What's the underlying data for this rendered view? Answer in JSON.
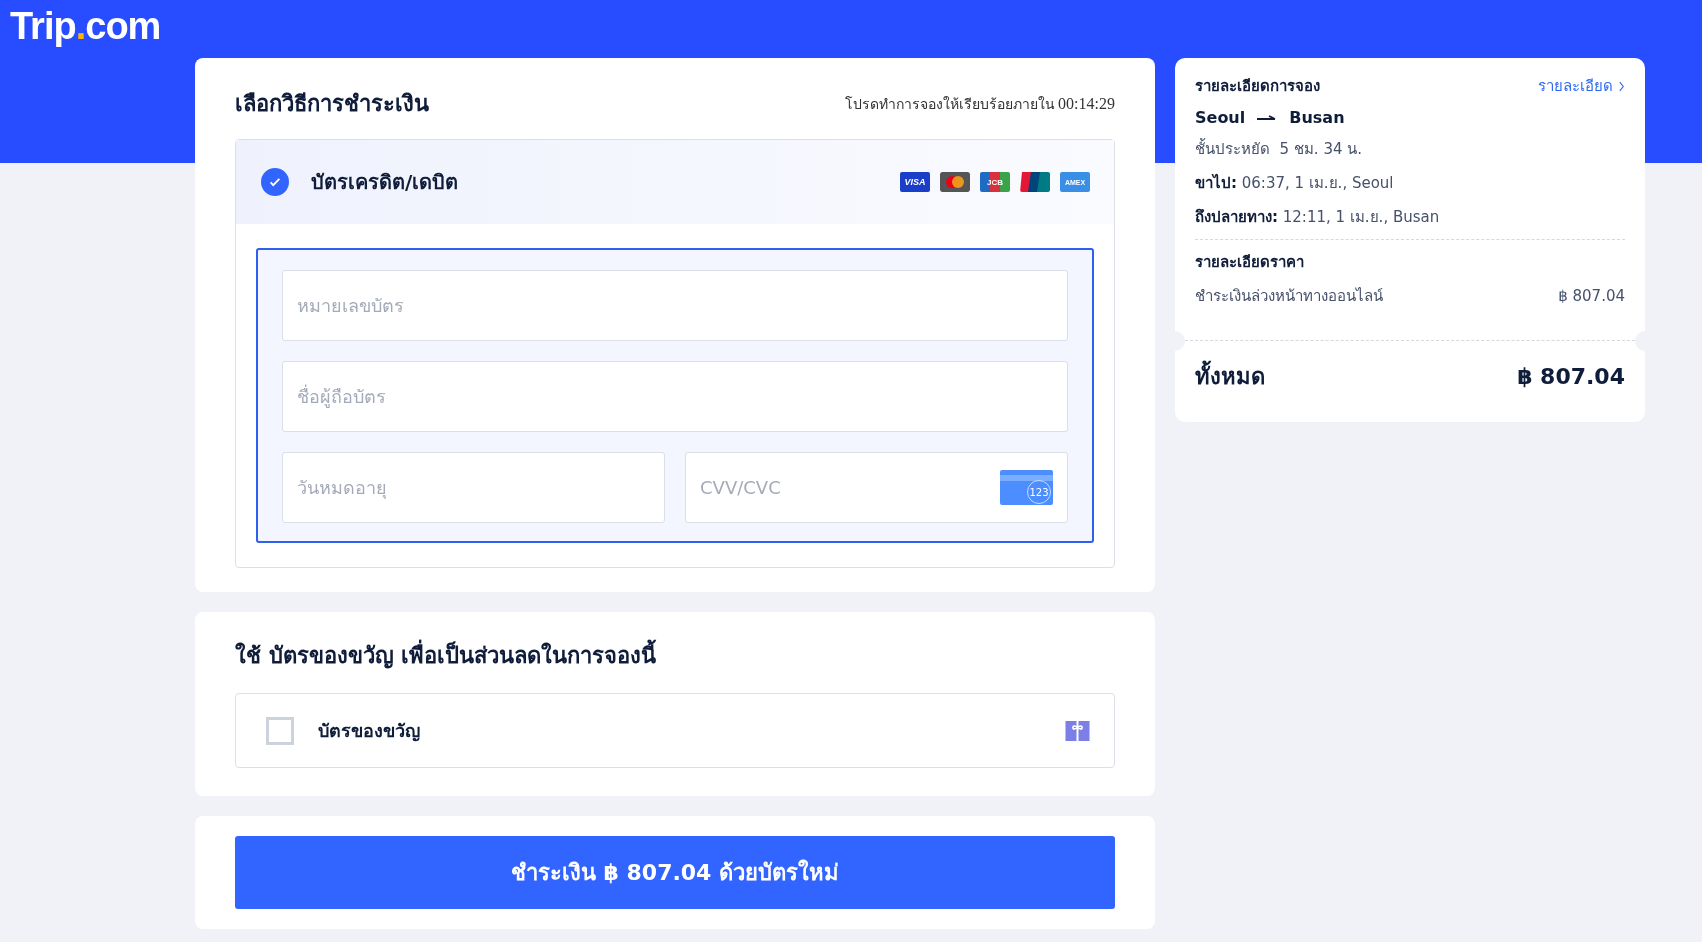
{
  "logo": {
    "parts": [
      "Trip",
      ".",
      "com"
    ]
  },
  "payment": {
    "title": "เลือกวิธีการชำระเงิน",
    "timer_label": "โปรดทำการจองให้เรียบร้อยภายใน",
    "timer": "00:14:29",
    "method": {
      "label": "บัตรเครดิต/เดบิต",
      "selected": true,
      "brands": [
        {
          "kind": "visa",
          "text": "VISA"
        },
        {
          "kind": "mastercard"
        },
        {
          "kind": "jcb",
          "text": "JCB"
        },
        {
          "kind": "unionpay"
        },
        {
          "kind": "amex",
          "text": "AMEX"
        }
      ]
    },
    "fields": [
      {
        "kind": "full",
        "placeholder": "หมายเลขบัตร"
      },
      {
        "kind": "full",
        "placeholder": "ชื่อผู้ถือบัตร"
      },
      {
        "kind": "half",
        "placeholder": "วันหมดอายุ"
      },
      {
        "kind": "cvv",
        "placeholder": "CVV/CVC",
        "icon_text": "123"
      }
    ]
  },
  "gift": {
    "title": "ใช้ บัตรของขวัญ เพื่อเป็นส่วนลดในการจองนี้",
    "option": {
      "label": "บัตรของขวัญ",
      "checked": false
    }
  },
  "pay_button": "ชำระเงิน ฿ 807.04 ด้วยบัตรใหม่",
  "summary": {
    "title": "รายละเอียดการจอง",
    "link": "รายละเอียด",
    "from": "Seoul",
    "to": "Busan",
    "lines": [
      {
        "kind": "plain",
        "label": "ชั้นประหยัด",
        "value": "5 ชม. 34 น."
      },
      {
        "kind": "bold",
        "label": "ขาไป:",
        "value": "06:37, 1 เม.ย., Seoul"
      },
      {
        "kind": "bold",
        "label": "ถึงปลายทาง:",
        "value": "12:11, 1 เม.ย., Busan"
      }
    ],
    "price_title": "รายละเอียดราคา",
    "prices": [
      {
        "label": "ชำระเงินล่วงหน้าทางออนไลน์",
        "value": "฿ 807.04"
      }
    ],
    "total_label": "ทั้งหมด",
    "total": "฿ 807.04"
  }
}
